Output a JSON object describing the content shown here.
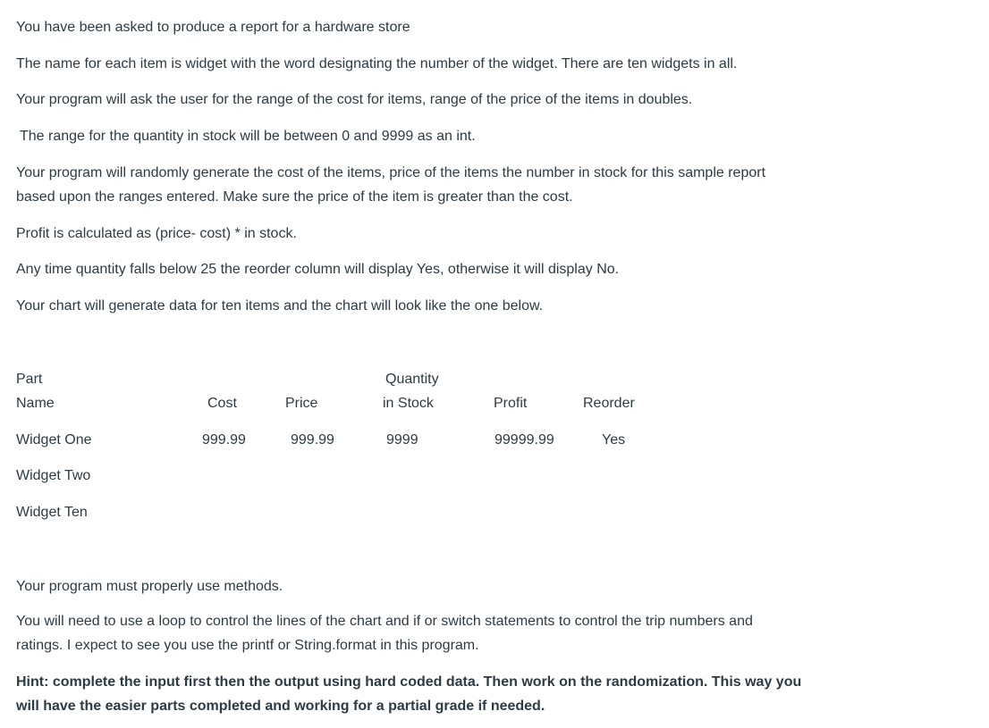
{
  "paragraphs": [
    "You have been asked to produce a report for a hardware store",
    "The name for each item is widget with the word designating the number of the widget. There are ten widgets in all.",
    "Your program will ask the user for the range of the cost for items, range of the price of the items in doubles.",
    "The range for the quantity in stock will be between 0 and 9999 as an int.",
    "Your program will randomly generate the cost of the items, price of the items the number in stock for this sample report",
    "based upon the ranges entered.  Make sure the price of the item is greater than the cost.",
    "Profit is calculated as (price- cost) * in stock.",
    "Any time quantity falls below 25 the reorder column will display Yes, otherwise it will display No.",
    "Your chart will generate data for ten items and the chart will look like the one below."
  ],
  "table": {
    "headers": {
      "part_line1": "Part",
      "part_line2": "Name",
      "cost": "Cost",
      "price": "Price",
      "qty_line1": "Quantity",
      "qty_line2": "in Stock",
      "profit": "Profit",
      "reorder": "Reorder"
    },
    "rows": [
      {
        "name": "Widget One",
        "cost": "999.99",
        "price": "999.99",
        "qty": "9999",
        "profit": "99999.99",
        "reorder": "Yes"
      },
      {
        "name": "Widget Two"
      },
      {
        "name": "Widget Ten"
      }
    ]
  },
  "footer": [
    "Your program must properly use methods.",
    "You will need to use a loop to control the lines of the chart and if or switch statements to control the trip numbers and",
    "ratings. I expect to see you use the printf or String.format in this program."
  ],
  "hint": [
    "Hint:  complete the input first then the output using hard coded data. Then work on the randomization.   This way you",
    "will have the easier parts completed and working for a partial grade if needed."
  ]
}
